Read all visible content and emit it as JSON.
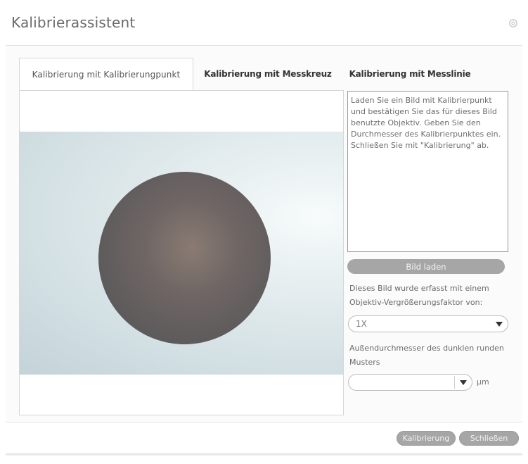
{
  "dialog": {
    "title": "Kalibrierassistent",
    "close_icon": "gear-icon"
  },
  "tabs": [
    {
      "label": "Kalibrierung mit Kalibrierungpunkt",
      "active": true
    },
    {
      "label": "Kalibrierung mit Messkreuz",
      "active": false
    },
    {
      "label": "Kalibrierung mit Messlinie",
      "active": false
    }
  ],
  "instructions": "Laden Sie ein Bild mit Kalibrierpunkt und bestätigen Sie das für dieses Bild benutzte Objektiv. Geben Sie den Durchmesser des Kalibrierpunktes ein. Schließen Sie mit \"Kalibrierung\" ab.",
  "load_button_label": "Bild laden",
  "magnification": {
    "label": "Dieses Bild wurde erfasst mit einem Objektiv-Vergrößerungsfaktor von:",
    "value": "1X"
  },
  "diameter": {
    "label": "Außendurchmesser des dunklen runden Musters",
    "value": "",
    "unit": "μm"
  },
  "footer": {
    "calibrate_label": "Kalibrierung",
    "close_label": "Schließen"
  },
  "colors": {
    "button_gray": "#a6a6a6",
    "border": "#d6d6d6"
  }
}
